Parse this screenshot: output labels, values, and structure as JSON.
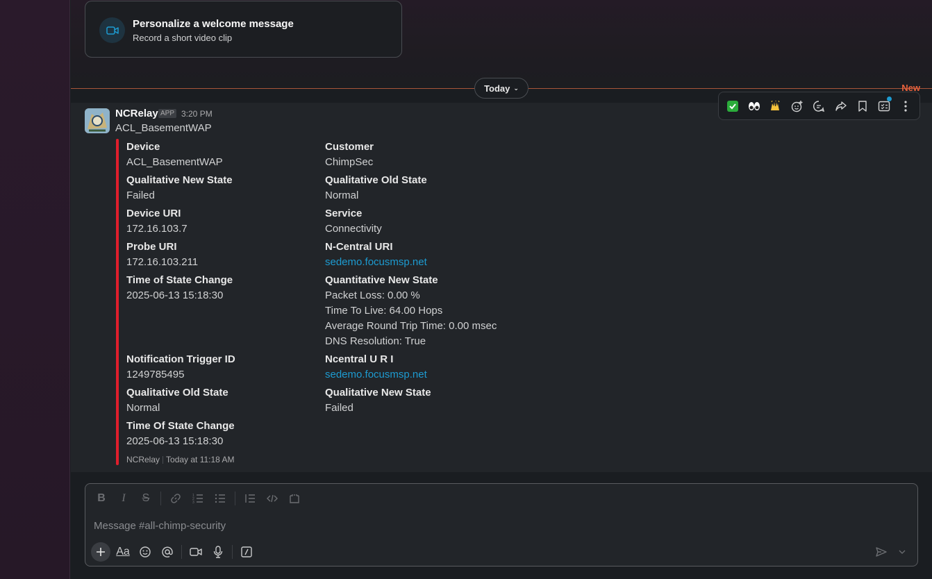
{
  "welcome": {
    "title": "Personalize a welcome message",
    "subtitle": "Record a short video clip"
  },
  "divider": {
    "today_label": "Today",
    "new_label": "New"
  },
  "message": {
    "sender": "NCRelay",
    "badge": "APP",
    "time": "3:20 PM",
    "text": "ACL_BasementWAP",
    "fields_left": [
      {
        "name": "Device",
        "value": "ACL_BasementWAP"
      },
      {
        "name": "Qualitative New State",
        "value": "Failed"
      },
      {
        "name": "Device URI",
        "value": "172.16.103.7"
      },
      {
        "name": "Probe URI",
        "value": "172.16.103.211"
      },
      {
        "name": "Time of State Change",
        "value": "2025-06-13 15:18:30"
      },
      {
        "name": "Notification Trigger ID",
        "value": "1249785495"
      },
      {
        "name": "Qualitative Old State",
        "value": "Normal"
      },
      {
        "name": "Time Of State Change",
        "value": "2025-06-13 15:18:30"
      }
    ],
    "fields_right": [
      {
        "name": "Customer",
        "value": "ChimpSec"
      },
      {
        "name": "Qualitative Old State",
        "value": "Normal"
      },
      {
        "name": "Service",
        "value": "Connectivity"
      },
      {
        "name": "N-Central URI",
        "value": "sedemo.focusmsp.net"
      },
      {
        "name": "Quantitative New State",
        "lines": [
          "Packet Loss: 0.00 %",
          "Time To Live: 64.00 Hops",
          "Average Round Trip Time: 0.00 msec",
          "DNS Resolution: True"
        ]
      },
      {
        "name": "Ncentral U R I",
        "value": "sedemo.focusmsp.net"
      },
      {
        "name": "Qualitative New State",
        "value": "Failed"
      }
    ],
    "footer_app": "NCRelay",
    "footer_time": "Today at 11:18 AM"
  },
  "actions": [
    "check-emoji",
    "eyes-emoji",
    "raised-hands-emoji",
    "add-reaction",
    "reply-in-thread",
    "forward",
    "save",
    "add-to-list",
    "more-actions"
  ],
  "composer": {
    "placeholder": "Message #all-chimp-security"
  },
  "colors": {
    "accent_new": "#e8613c",
    "link": "#1d9bd1",
    "attachment_bar": "#e01e2c"
  }
}
